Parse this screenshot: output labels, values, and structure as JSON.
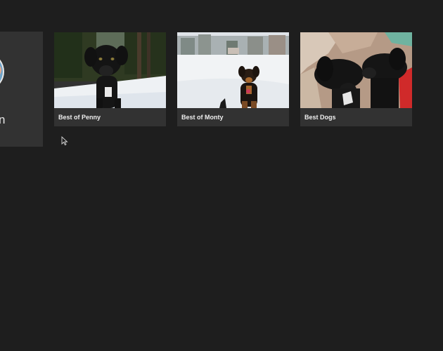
{
  "side_panel": {
    "partial_label": "n"
  },
  "albums": [
    {
      "title": "Best of Penny"
    },
    {
      "title": "Best of Monty"
    },
    {
      "title": "Best Dogs"
    }
  ],
  "colors": {
    "background": "#1e1e1e",
    "card": "#323232",
    "text": "#f0f0f0"
  },
  "icons": {
    "cursor": "mouse-pointer-icon"
  }
}
